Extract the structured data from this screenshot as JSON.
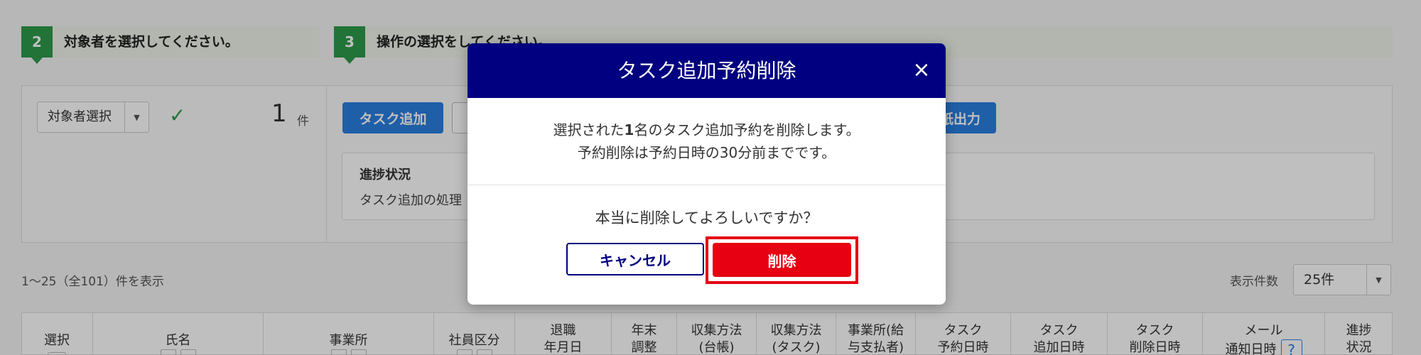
{
  "steps": [
    {
      "number": "2",
      "label": "対象者を選択してください。"
    },
    {
      "number": "3",
      "label": "操作の選択をしてください。"
    }
  ],
  "panel": {
    "select_label": "対象者選択",
    "count_value": "1",
    "count_unit": "件",
    "task_add_button": "タスク追加",
    "output_button": "紙出力",
    "progress_title": "進捗状況",
    "progress_text": "タスク追加の処理"
  },
  "listing": {
    "range_text": "1〜25（全101）件を表示",
    "per_page_label": "表示件数",
    "per_page_value": "25件"
  },
  "table": {
    "headers": [
      {
        "line1": "選択",
        "line2": ""
      },
      {
        "line1": "氏名",
        "line2": ""
      },
      {
        "line1": "事業所",
        "line2": ""
      },
      {
        "line1": "社員区分",
        "line2": ""
      },
      {
        "line1": "退職",
        "line2": "年月日"
      },
      {
        "line1": "年末",
        "line2": "調整"
      },
      {
        "line1": "収集方法",
        "line2": "(台帳)"
      },
      {
        "line1": "収集方法",
        "line2": "(タスク)"
      },
      {
        "line1": "事業所(給",
        "line2": "与支払者)"
      },
      {
        "line1": "タスク",
        "line2": "予約日時"
      },
      {
        "line1": "タスク",
        "line2": "追加日時"
      },
      {
        "line1": "タスク",
        "line2": "削除日時"
      },
      {
        "line1": "メール",
        "line2": "通知日時"
      },
      {
        "line1": "進捗",
        "line2": "状況"
      }
    ],
    "help_icon": "?"
  },
  "modal": {
    "title": "タスク追加予約削除",
    "close_icon": "×",
    "message_prefix": "選択された",
    "message_count": "1",
    "message_suffix": "名のタスク追加予約を削除します。",
    "message_line2": "予約削除は予約日時の30分前までです。",
    "confirm_text": "本当に削除してよろしいですか？",
    "cancel_label": "キャンセル",
    "delete_label": "削除"
  },
  "colors": {
    "modal_header": "#000080",
    "delete_button": "#e60012",
    "highlight_border": "#e60012",
    "step_badge": "#2e9a4a",
    "primary_button": "#2a7fe0"
  }
}
